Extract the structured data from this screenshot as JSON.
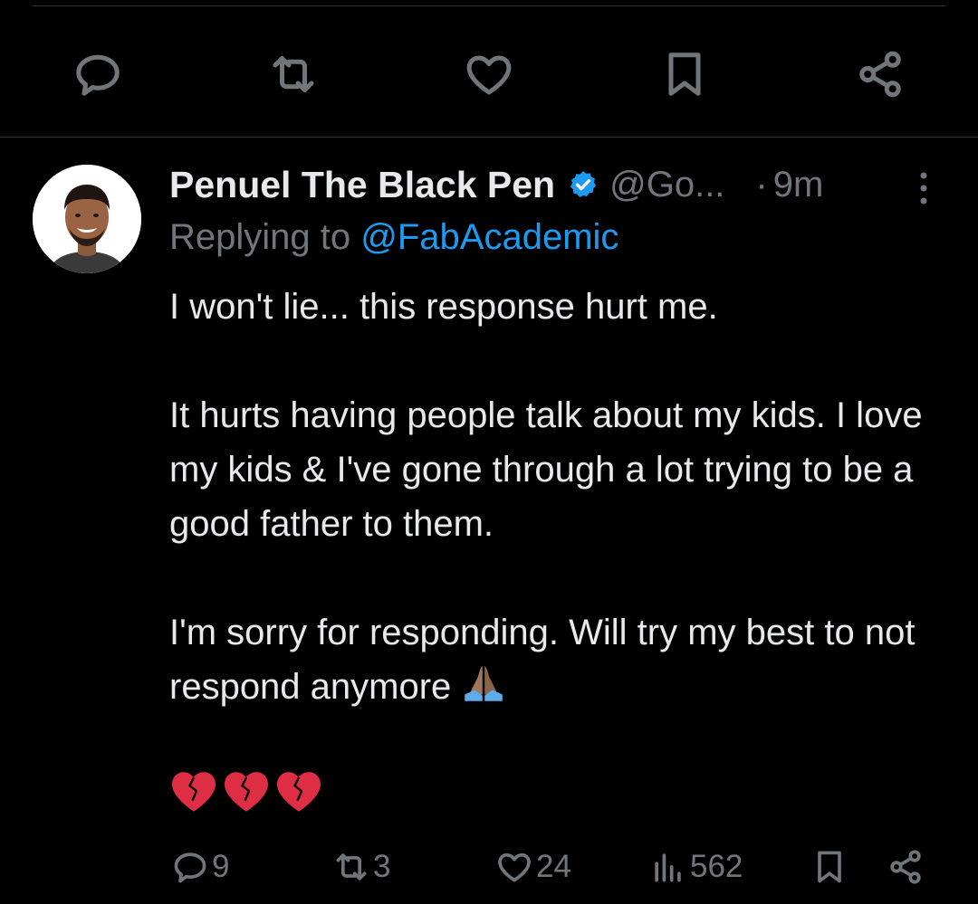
{
  "top_actions": {
    "icons": [
      "reply-icon",
      "retweet-icon",
      "like-icon",
      "bookmark-icon",
      "share-icon"
    ]
  },
  "tweet": {
    "display_name": "Penuel The Black Pen",
    "verified_icon": "verified-badge-icon",
    "handle": "@Go...",
    "separator": "·",
    "time": "9m",
    "replying_prefix": "Replying to",
    "replying_to": "@FabAcademic",
    "paragraphs": [
      "I won't lie... this response hurt me.",
      "It hurts having people talk about my kids. I love my kids & I've gone through a lot trying to be a good father to them.",
      "I'm sorry for responding. Will try my best to not respond anymore"
    ],
    "pray_emoji": "folded-hands-emoji",
    "heart_emojis": [
      "broken-heart-emoji",
      "broken-heart-emoji",
      "broken-heart-emoji"
    ]
  },
  "stats": {
    "replies": "9",
    "retweets": "3",
    "likes": "24",
    "views": "562"
  },
  "colors": {
    "background": "#000000",
    "text": "#e7e9ea",
    "muted": "#71767b",
    "link": "#1d9bf0",
    "divider": "#2f3336",
    "broken_heart": "#dd2e44"
  }
}
